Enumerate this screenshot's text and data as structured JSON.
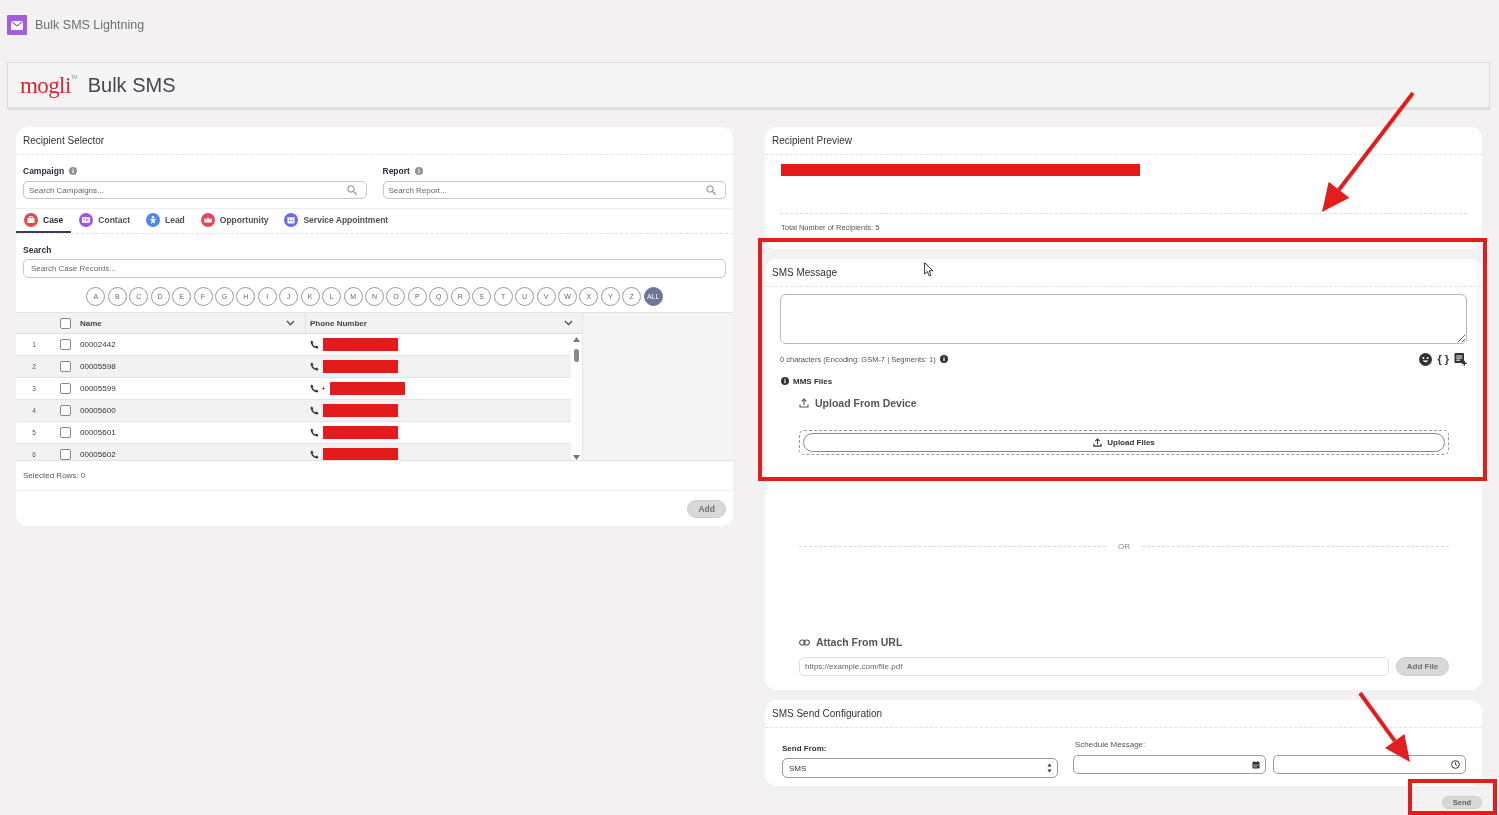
{
  "app_bar": {
    "title": "Bulk SMS Lightning"
  },
  "header": {
    "logo": "mogli$^{TM}$",
    "title": "Bulk SMS"
  },
  "recipient_selector": {
    "title": "Recipient Selector",
    "campaign": {
      "label": "Campaign",
      "placeholder": "Search Campaigns..."
    },
    "report": {
      "label": "Report",
      "placeholder": "Search Report..."
    },
    "tabs": [
      {
        "label": "Case",
        "kind": "case",
        "color": "#e5484d",
        "selected": true
      },
      {
        "label": "Contact",
        "kind": "contact",
        "color": "#a155e0",
        "selected": false
      },
      {
        "label": "Lead",
        "kind": "lead",
        "color": "#4f87ea",
        "selected": false
      },
      {
        "label": "Opportunity",
        "kind": "opportunity",
        "color": "#e2475a",
        "selected": false
      },
      {
        "label": "Service Appointment",
        "kind": "service_appointment",
        "color": "#6a6de8",
        "selected": false
      }
    ],
    "search": {
      "label": "Search",
      "placeholder": "Search Case Records..."
    },
    "letters": [
      {
        "label": "A",
        "selected": false
      },
      {
        "label": "B",
        "selected": false
      },
      {
        "label": "C",
        "selected": false
      },
      {
        "label": "D",
        "selected": false
      },
      {
        "label": "E",
        "selected": false
      },
      {
        "label": "F",
        "selected": false
      },
      {
        "label": "G",
        "selected": false
      },
      {
        "label": "H",
        "selected": false
      },
      {
        "label": "I",
        "selected": false
      },
      {
        "label": "J",
        "selected": false
      },
      {
        "label": "K",
        "selected": false
      },
      {
        "label": "L",
        "selected": false
      },
      {
        "label": "M",
        "selected": false
      },
      {
        "label": "N",
        "selected": false
      },
      {
        "label": "O",
        "selected": false
      },
      {
        "label": "P",
        "selected": false
      },
      {
        "label": "Q",
        "selected": false
      },
      {
        "label": "R",
        "selected": false
      },
      {
        "label": "S",
        "selected": false
      },
      {
        "label": "T",
        "selected": false
      },
      {
        "label": "U",
        "selected": false
      },
      {
        "label": "V",
        "selected": false
      },
      {
        "label": "W",
        "selected": false
      },
      {
        "label": "X",
        "selected": false
      },
      {
        "label": "Y",
        "selected": false
      },
      {
        "label": "Z",
        "selected": false
      },
      {
        "label": "ALL",
        "selected": true
      }
    ],
    "table": {
      "select_all": {
        "checked": false
      },
      "columns": [
        {
          "label": "Name"
        },
        {
          "label": "Phone Number"
        }
      ],
      "rows": [
        {
          "number": "1",
          "name": "00002442",
          "selected": false,
          "phone_redacted": true
        },
        {
          "number": "2",
          "name": "00005598",
          "selected": false,
          "phone_redacted": true
        },
        {
          "number": "3",
          "name": "00005599",
          "selected": false,
          "phone": "+",
          "phone_redacted": true
        },
        {
          "number": "4",
          "name": "00005600",
          "selected": false,
          "phone_redacted": true
        },
        {
          "number": "5",
          "name": "00005601",
          "selected": false,
          "phone_redacted": true
        },
        {
          "number": "6",
          "name": "00005602",
          "selected": false,
          "phone_redacted": true
        }
      ]
    },
    "selected_rows": "Selected Rows: 0",
    "add_button": {
      "label": "Add",
      "disabled": true
    }
  },
  "recipient_preview": {
    "title": "Recipient Preview",
    "redacted": true,
    "total": "Total Number of Recipients: 5"
  },
  "sms_message": {
    "title": "SMS Message",
    "counter": "0 characters (Encoding: GSM-7 | Segments: 1)",
    "merge_fields": "{ }",
    "mms_label": "MMS Files",
    "upload_heading": "Upload From Device",
    "upload_button": "Upload Files",
    "divider": "OR",
    "url_heading": "Attach From URL",
    "url_field": {
      "placeholder": "https://example.com/file.pdf"
    },
    "add_file_button": {
      "label": "Add File",
      "disabled": true
    }
  },
  "send_config": {
    "title": "SMS Send Configuration",
    "send_from": {
      "label": "Send From:",
      "value": "SMS"
    },
    "schedule": {
      "label": "Schedule Message:"
    }
  },
  "send_button": {
    "label": "Send",
    "disabled": true
  },
  "annotations": [
    {
      "kind": "arrow"
    },
    {
      "kind": "frame"
    },
    {
      "kind": "arrow"
    },
    {
      "kind": "frame"
    }
  ]
}
